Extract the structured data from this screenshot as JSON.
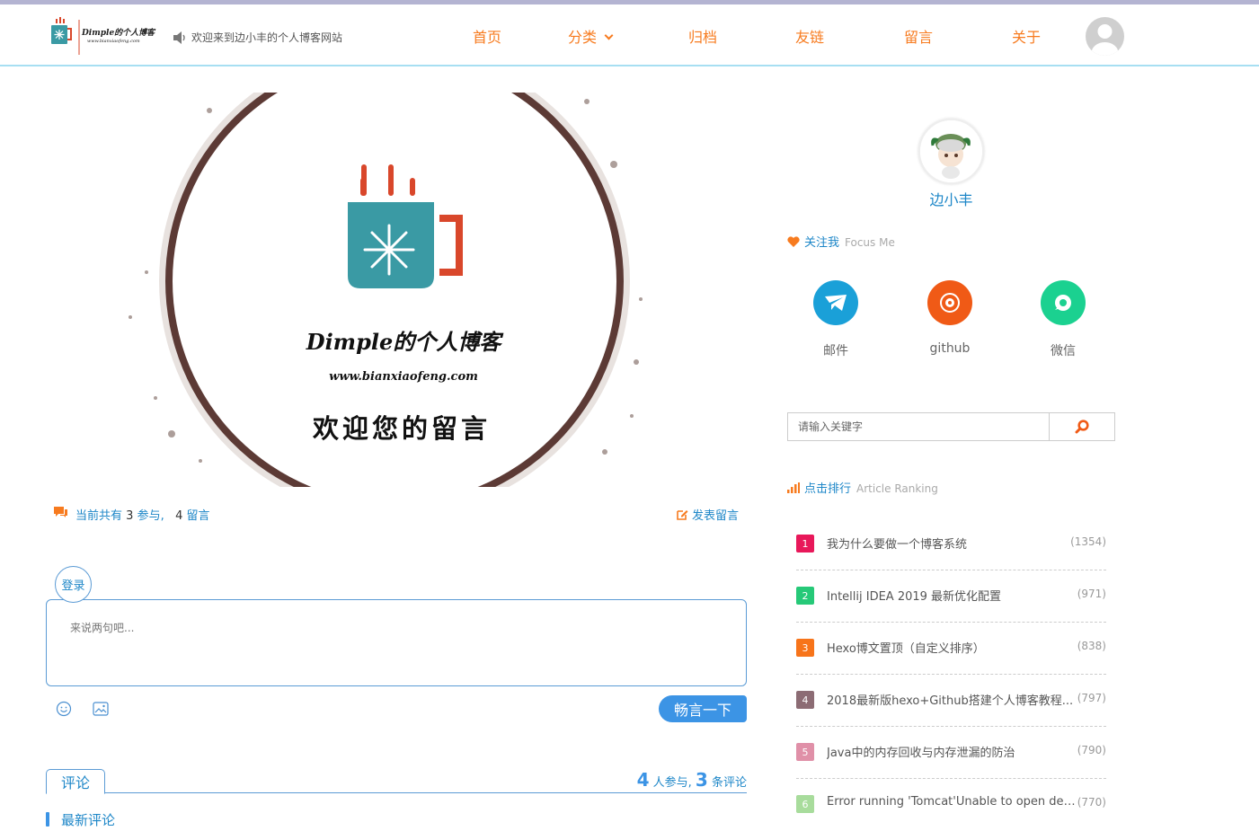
{
  "header": {
    "logo_text": "Dimple的个人博客",
    "logo_url_text": "www.bianxiaofeng.com",
    "welcome": "欢迎来到边小丰的个人博客网站",
    "nav": [
      {
        "label": "首页"
      },
      {
        "label": "分类"
      },
      {
        "label": "归档"
      },
      {
        "label": "友链"
      },
      {
        "label": "留言"
      },
      {
        "label": "关于"
      }
    ]
  },
  "banner": {
    "title": "Dimple的个人博客",
    "url": "www.bianxiaofeng.com",
    "tagline": "欢迎您的留言"
  },
  "stats": {
    "prefix": "当前共有",
    "participants": "3",
    "participants_unit": "参与,",
    "messages": "4",
    "messages_unit": "留言",
    "post_label": "发表留言"
  },
  "comment_form": {
    "login_label": "登录",
    "placeholder": "来说两句吧...",
    "submit_label": "畅言一下"
  },
  "comment_tabs": {
    "tab_label": "评论",
    "people": "4",
    "people_unit": "人参与,",
    "comments": "3",
    "comments_unit": "条评论",
    "latest_label": "最新评论"
  },
  "profile": {
    "name": "边小丰"
  },
  "focus": {
    "title": "关注我",
    "title_en": "Focus Me",
    "items": [
      {
        "label": "邮件",
        "color": "#1aa0d8",
        "icon": "mail-icon"
      },
      {
        "label": "github",
        "color": "#f05a16",
        "icon": "github-icon"
      },
      {
        "label": "微信",
        "color": "#1bd190",
        "icon": "wechat-icon"
      }
    ]
  },
  "search": {
    "placeholder": "请输入关键字"
  },
  "ranking": {
    "title": "点击排行",
    "title_en": "Article Ranking",
    "items": [
      {
        "rank": "1",
        "title": "我为什么要做一个博客系统",
        "count": "(1354)",
        "color": "#e8185a"
      },
      {
        "rank": "2",
        "title": "Intellij IDEA 2019 最新优化配置",
        "count": "(971)",
        "color": "#26c978"
      },
      {
        "rank": "3",
        "title": "Hexo博文置顶（自定义排序）",
        "count": "(838)",
        "color": "#f7741a"
      },
      {
        "rank": "4",
        "title": "2018最新版hexo+Github搭建个人博客教程...",
        "count": "(797)",
        "color": "#8c6c74"
      },
      {
        "rank": "5",
        "title": "Java中的内存回收与内存泄漏的防治",
        "count": "(790)",
        "color": "#e090a8"
      },
      {
        "rank": "6",
        "title": "Error running 'Tomcat'Unable to open deb...",
        "count": "(770)",
        "color": "#a8dc9c"
      }
    ]
  }
}
